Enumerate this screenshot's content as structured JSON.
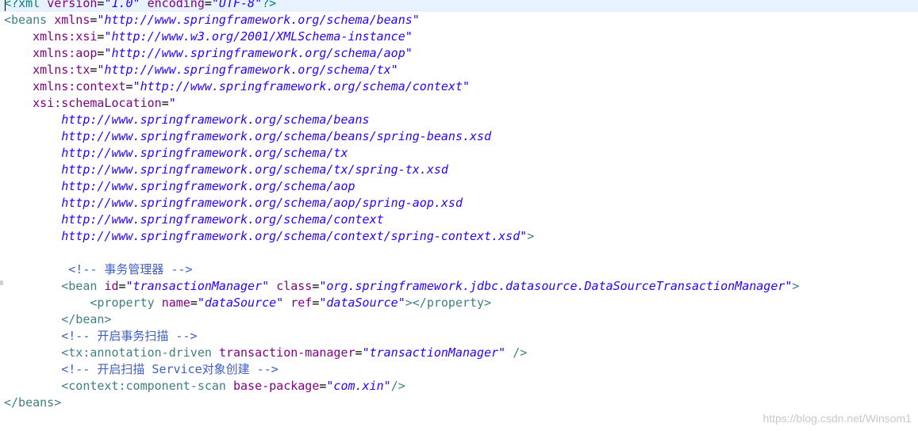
{
  "editor": {
    "lines": {
      "l1": {
        "open": "<?",
        "name": "xml",
        "a1": "version",
        "v1": "\"1.0\"",
        "a2": "encoding",
        "v2": "\"UTF-8\"",
        "close": "?>"
      },
      "l2": {
        "tag": "<beans",
        "attr": "xmlns",
        "val": "\"http://www.springframework.org/schema/beans\""
      },
      "l3": {
        "attr": "xmlns:xsi",
        "val": "\"http://www.w3.org/2001/XMLSchema-instance\""
      },
      "l4": {
        "attr": "xmlns:aop",
        "val": "\"http://www.springframework.org/schema/aop\""
      },
      "l5": {
        "attr": "xmlns:tx",
        "val": "\"http://www.springframework.org/schema/tx\""
      },
      "l6": {
        "attr": "xmlns:context",
        "val": "\"http://www.springframework.org/schema/context\""
      },
      "l7": {
        "attr": "xsi:schemaLocation",
        "val": "\""
      },
      "l8": "http://www.springframework.org/schema/beans",
      "l9": "http://www.springframework.org/schema/beans/spring-beans.xsd",
      "l10": "http://www.springframework.org/schema/tx",
      "l11": "http://www.springframework.org/schema/tx/spring-tx.xsd",
      "l12": "http://www.springframework.org/schema/aop",
      "l13": "http://www.springframework.org/schema/aop/spring-aop.xsd",
      "l14": "http://www.springframework.org/schema/context",
      "l15": {
        "val": "http://www.springframework.org/schema/context/spring-context.xsd\"",
        "close": ">"
      },
      "l16": "<!-- 事务管理器 -->",
      "l17": {
        "tag": "<bean",
        "a1": "id",
        "v1": "\"transactionManager\"",
        "a2": "class",
        "v2": "\"org.springframework.jdbc.datasource.DataSourceTransactionManager\"",
        "close": ">"
      },
      "l18": {
        "tag": "<property",
        "a1": "name",
        "v1": "\"dataSource\"",
        "a2": "ref",
        "v2": "\"dataSource\"",
        "close": "></property>"
      },
      "l19": "</bean>",
      "l20": "<!-- 开启事务扫描 -->",
      "l21": {
        "tag": "<tx:annotation-driven",
        "a1": "transaction-manager",
        "v1": "\"transactionManager\"",
        "close": " />"
      },
      "l22": "<!-- 开启扫描 Service对象创建 -->",
      "l23": {
        "tag": "<context:component-scan",
        "a1": "base-package",
        "v1": "\"com.xin\"",
        "close": "/>"
      },
      "l24": "</beans>"
    }
  },
  "watermark": "https://blog.csdn.net/Winsom1"
}
